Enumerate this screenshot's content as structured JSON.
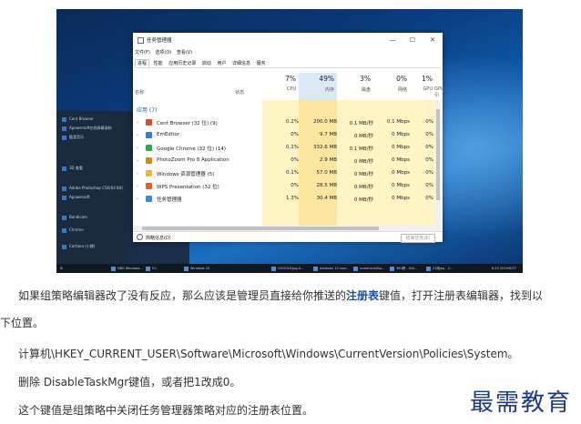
{
  "window": {
    "title": "任务管理器",
    "min_icon": "—",
    "max_icon": "☐",
    "close_icon": "✕"
  },
  "menu": [
    "文件(F)",
    "选项(O)",
    "查看(V)"
  ],
  "tabs": [
    "进程",
    "性能",
    "应用历史记录",
    "启动",
    "用户",
    "详细信息",
    "服务"
  ],
  "columns": {
    "name": "名称",
    "status": "状态",
    "cpu": {
      "pct": "7%",
      "label": "CPU"
    },
    "mem": {
      "pct": "49%",
      "label": "内存"
    },
    "disk": {
      "pct": "3%",
      "label": "磁盘"
    },
    "net": {
      "pct": "0%",
      "label": "网络"
    },
    "gpu": {
      "pct": "1%",
      "label": "GPU"
    },
    "gpu_engine": "GPU 引"
  },
  "group_label": "应用 (7)",
  "rows": [
    {
      "name": "Cent Browser (32 位) (9)",
      "cpu": "0.2%",
      "mem": "200.0 MB",
      "disk": "0.1 MB/秒",
      "net": "0.1 Mbps",
      "gpu": "0%",
      "color": "#e04a2a"
    },
    {
      "name": "EmEditor",
      "cpu": "0%",
      "mem": "9.7 MB",
      "disk": "0 MB/秒",
      "net": "0 Mbps",
      "gpu": "0%",
      "color": "#3a7bd5"
    },
    {
      "name": "Google Chrome (32 位) (14)",
      "cpu": "0.1%",
      "mem": "332.6 MB",
      "disk": "0.1 MB/秒",
      "net": "0 Mbps",
      "gpu": "0%",
      "color": "#2fa84f"
    },
    {
      "name": "PhotoZoom Pro 8 Application",
      "cpu": "0%",
      "mem": "2.9 MB",
      "disk": "0 MB/秒",
      "net": "0 Mbps",
      "gpu": "0%",
      "color": "#d08a1a"
    },
    {
      "name": "Windows 资源管理器 (5)",
      "cpu": "0.1%",
      "mem": "57.0 MB",
      "disk": "0 MB/秒",
      "net": "0 Mbps",
      "gpu": "0%",
      "color": "#e5b93a"
    },
    {
      "name": "WPS Presentation (32 位)",
      "cpu": "0%",
      "mem": "28.5 MB",
      "disk": "0 MB/秒",
      "net": "0 Mbps",
      "gpu": "0%",
      "color": "#e0642a"
    },
    {
      "name": "任务管理器",
      "cpu": "1.3%",
      "mem": "30.4 MB",
      "disk": "0 MB/秒",
      "net": "0 Mbps",
      "gpu": "0%",
      "color": "#3a8ad5"
    }
  ],
  "bottom": {
    "brief": "简略信息(D)",
    "end_task": "结束任务(E)"
  },
  "startmenu": {
    "items": [
      "Cent Browser",
      "Apowersoft在线屏幕录制",
      "酷我音乐",
      "3D 查看",
      "Adobe Photoshop CS6(64 Bit)",
      "Apowersoft",
      "Bandicam",
      "Chrome",
      "Cortana (小娜)"
    ]
  },
  "taskbar": {
    "items": [
      "NBG Windows...",
      "D:\\",
      "Windows 10",
      "GOOGLE/jpg-S...",
      "windows 10 user...",
      "screenshot&p...",
      "360看 - Snk...",
      "21版jpg - 2..."
    ],
    "time": "8:43",
    "date": "2019/6/27"
  },
  "article": {
    "p1_before": "如果组策略编辑器改了没有反应，那么应该是管理员直接给你推送的",
    "p1_link": "注册表",
    "p1_after": "键值，打开注册表编辑器，找到以",
    "p1_cont": "下位置。",
    "p2": "计算机\\HKEY_CURRENT_USER\\Software\\Microsoft\\Windows\\CurrentVersion\\Policies\\System。",
    "p3": "删除 DisableTaskMgr键值，或者把1改成0。",
    "p4": "这个键值是组策略中关闭任务管理器策略对应的注册表位置。"
  },
  "watermark": "最需教育"
}
